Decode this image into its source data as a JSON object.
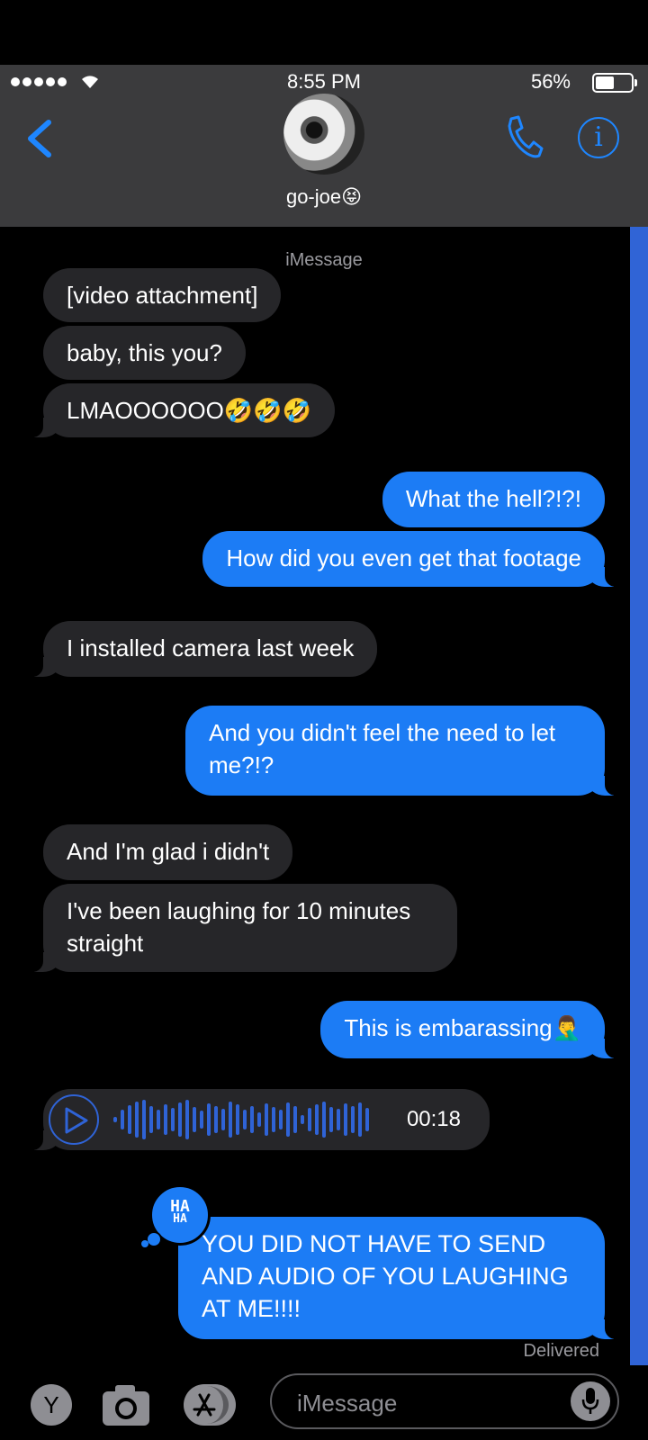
{
  "status_bar": {
    "time": "8:55 PM",
    "battery": "56%",
    "battery_level": 0.56
  },
  "header": {
    "contact_name": "go-joe😝",
    "info_glyph": "i"
  },
  "service_label": "iMessage",
  "messages": [
    {
      "side": "in",
      "text": "[video attachment]"
    },
    {
      "side": "in",
      "text": "baby, this you?"
    },
    {
      "side": "in",
      "text": "LMAOOOOOO🤣🤣🤣"
    },
    {
      "side": "out",
      "text": "What the hell?!?!"
    },
    {
      "side": "out",
      "text": "How did you even get that footage"
    },
    {
      "side": "in",
      "text": "I installed camera last week"
    },
    {
      "side": "out",
      "text": "And you didn't feel the need to let me?!?"
    },
    {
      "side": "in",
      "text": "And I'm glad i didn't"
    },
    {
      "side": "in",
      "text": "I've been laughing for 10 minutes straight"
    },
    {
      "side": "out",
      "text": "This is embarassing🤦‍♂️"
    },
    {
      "side": "out",
      "text": "YOU DID NOT HAVE TO SEND AND AUDIO OF YOU LAUGHING AT ME!!!!"
    }
  ],
  "audio_message": {
    "duration": "00:18"
  },
  "tapback": {
    "line1": "HA",
    "line2": "HA"
  },
  "delivered_label": "Delivered",
  "input_bar": {
    "app_icon_letter": "Y",
    "placeholder": "iMessage"
  },
  "colors": {
    "outgoing": "#1c7cf5",
    "incoming": "#262629",
    "accent": "#1e86ff",
    "header": "#3b3b3d"
  },
  "icons": [
    "back-chevron-icon",
    "phone-icon",
    "info-icon",
    "wifi-icon",
    "play-icon",
    "camera-icon",
    "app-store-icon",
    "microphone-icon"
  ]
}
